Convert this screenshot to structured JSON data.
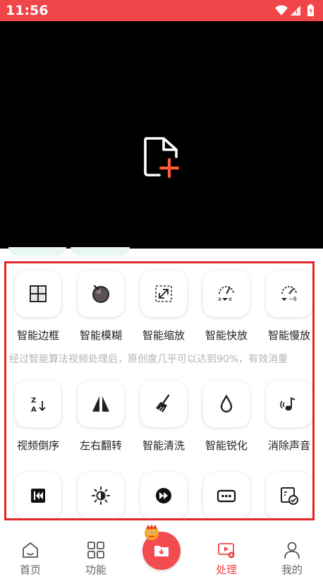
{
  "status_bar": {
    "time": "11:56",
    "color": "#f0464a"
  },
  "preview": {
    "icon": "add-file-icon"
  },
  "features_row1": [
    {
      "label": "智能边框",
      "icon": "frame-icon"
    },
    {
      "label": "智能模糊",
      "icon": "blur-icon"
    },
    {
      "label": "智能缩放",
      "icon": "zoom-icon"
    },
    {
      "label": "智能快放",
      "icon": "fast-forward-gauge-icon"
    },
    {
      "label": "智能慢放",
      "icon": "slow-motion-gauge-icon"
    }
  ],
  "marquee": "经过智能算法视频处理后，原创度几乎可以达到90%，有效消重",
  "features_row2": [
    {
      "label": "视频倒序",
      "icon": "reverse-order-icon"
    },
    {
      "label": "左右翻转",
      "icon": "flip-icon"
    },
    {
      "label": "智能清洗",
      "icon": "broom-icon"
    },
    {
      "label": "智能锐化",
      "icon": "drop-icon"
    },
    {
      "label": "消除声音",
      "icon": "mute-note-icon"
    }
  ],
  "features_row3": [
    {
      "icon": "rewind-icon"
    },
    {
      "icon": "brightness-icon"
    },
    {
      "icon": "fast-forward-icon"
    },
    {
      "icon": "subtitle-icon"
    },
    {
      "icon": "verify-icon"
    }
  ],
  "bottom_nav": {
    "home": "首页",
    "functions": "功能",
    "process": "处理",
    "mine": "我的",
    "active": "process",
    "accent": "#f0464a"
  }
}
